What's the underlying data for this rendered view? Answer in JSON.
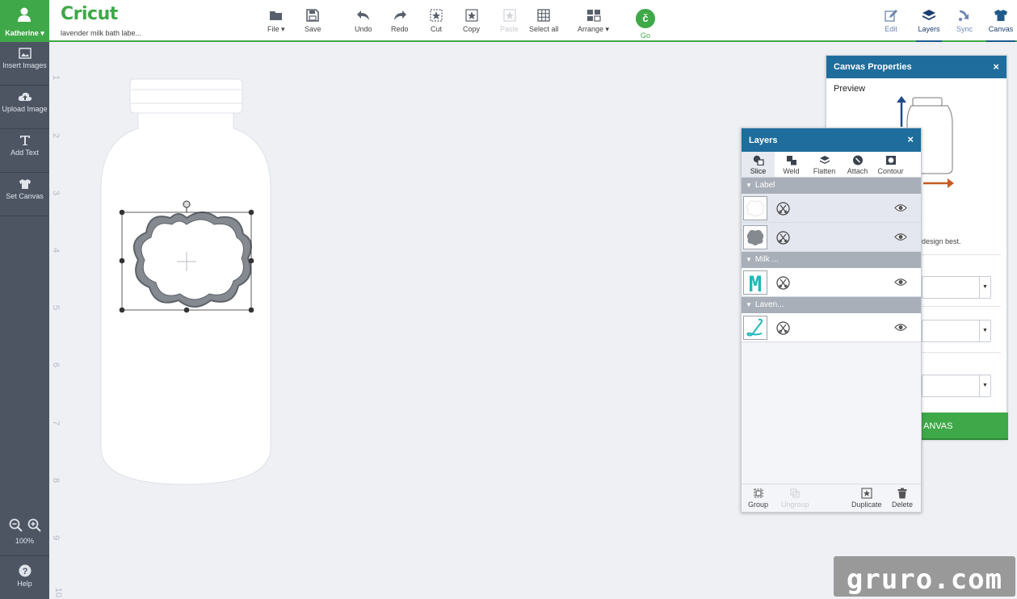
{
  "user": {
    "name": "Katherine"
  },
  "sidebar": {
    "items": [
      {
        "label": "Insert Images"
      },
      {
        "label": "Upload Image"
      },
      {
        "label": "Add Text"
      },
      {
        "label": "Set Canvas"
      }
    ],
    "zoom": "100%",
    "help": "Help"
  },
  "header": {
    "logo": "Cricut",
    "project_name": "lavender milk bath labe...",
    "toolbar": {
      "file": "File",
      "save": "Save",
      "undo": "Undo",
      "redo": "Redo",
      "cut": "Cut",
      "copy": "Copy",
      "paste": "Paste",
      "select_all": "Select all",
      "arrange": "Arrange",
      "go": "Go"
    },
    "tabs": {
      "edit": "Edit",
      "layers": "Layers",
      "sync": "Sync",
      "canvas": "Canvas"
    }
  },
  "ruler": {
    "marks": [
      "1",
      "2",
      "3",
      "4",
      "5",
      "6",
      "7",
      "8",
      "9",
      "10"
    ]
  },
  "canvas_properties": {
    "title": "Canvas Properties",
    "preview": "Preview",
    "description": "design best.",
    "apply_button": "ANVAS"
  },
  "layers_panel": {
    "title": "Layers",
    "tools": {
      "slice": "Slice",
      "weld": "Weld",
      "flatten": "Flatten",
      "attach": "Attach",
      "contour": "Contour"
    },
    "groups": [
      {
        "name": "Label"
      },
      {
        "name": "Milk ..."
      },
      {
        "name": "Laven..."
      }
    ],
    "footer": {
      "group": "Group",
      "ungroup": "Ungroup",
      "duplicate": "Duplicate",
      "delete": "Delete"
    }
  },
  "watermark": "gruro.com",
  "colors": {
    "brand_green": "#3fa848",
    "panel_header_blue": "#1e6d9c",
    "sidebar_bg": "#4d5563",
    "teal_accent": "#1fb8b8"
  }
}
